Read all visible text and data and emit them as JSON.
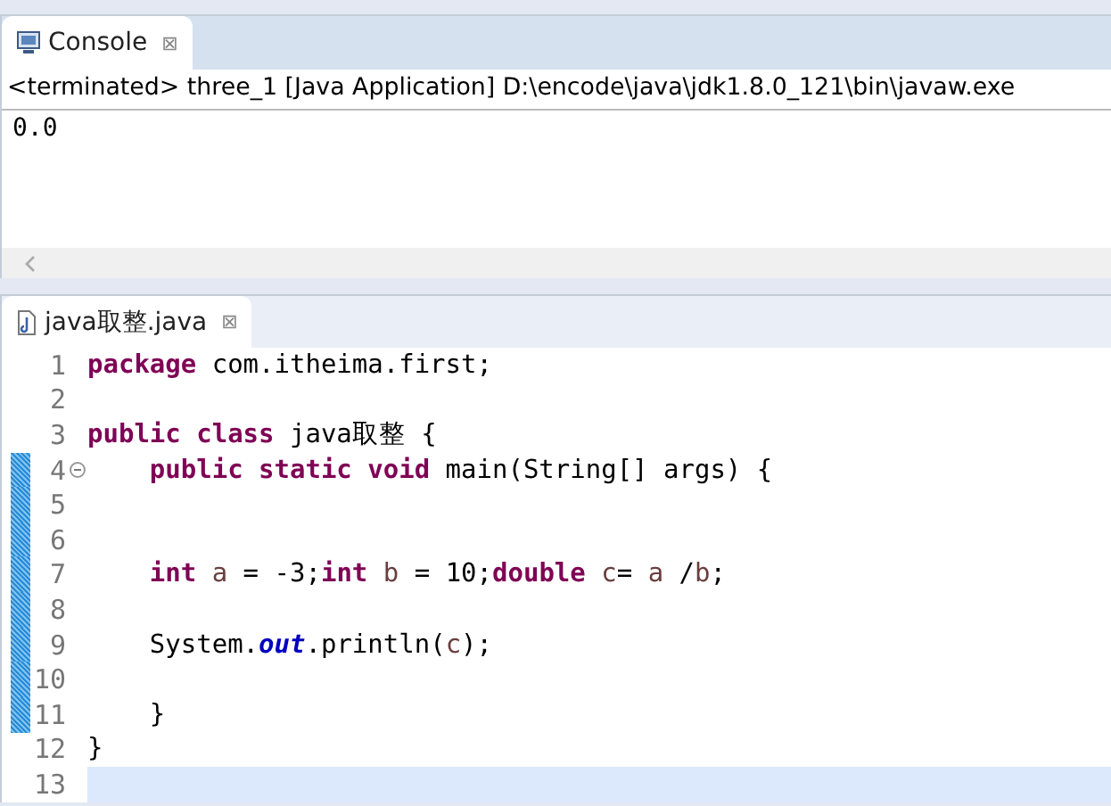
{
  "console": {
    "tab": {
      "title": "Console",
      "close": "⊠",
      "selected": true
    },
    "header": "<terminated> three_1 [Java Application] D:\\encode\\java\\jdk1.8.0_121\\bin\\javaw.exe",
    "output": [
      "0.0"
    ]
  },
  "editor": {
    "tab": {
      "title": "java取整.java",
      "close": "⊠",
      "selected": true
    },
    "lines": [
      {
        "number": "1",
        "changed": false,
        "current": false,
        "foldable": false,
        "tokens": [
          {
            "kind": "keyword",
            "text": "package"
          },
          {
            "kind": "text",
            "text": " com.itheima.first;"
          }
        ]
      },
      {
        "number": "2",
        "changed": false,
        "current": false,
        "foldable": false
      },
      {
        "number": "3",
        "changed": false,
        "current": false,
        "foldable": false,
        "tokens": [
          {
            "kind": "keyword",
            "text": "public "
          },
          {
            "kind": "keyword",
            "text": "class"
          },
          {
            "kind": "text",
            "text": " java取整 {"
          }
        ]
      },
      {
        "number": "4",
        "changed": true,
        "current": false,
        "foldable": true,
        "tokens": [
          {
            "kind": "keyword",
            "text": "    public "
          },
          {
            "kind": "keyword",
            "text": "static "
          },
          {
            "kind": "keyword",
            "text": "void"
          },
          {
            "kind": "text",
            "text": " main(String[] args) {"
          }
        ]
      },
      {
        "number": "5",
        "changed": true,
        "current": false,
        "foldable": false
      },
      {
        "number": "6",
        "changed": true,
        "current": false,
        "foldable": false
      },
      {
        "number": "7",
        "changed": true,
        "current": false,
        "foldable": false,
        "tokens": [
          {
            "kind": "keyword",
            "text": "    int "
          },
          {
            "kind": "local",
            "text": "a"
          },
          {
            "kind": "text",
            "text": " = -3;"
          },
          {
            "kind": "keyword",
            "text": "int "
          },
          {
            "kind": "local",
            "text": "b"
          },
          {
            "kind": "text",
            "text": " = 10;"
          },
          {
            "kind": "keyword",
            "text": "double "
          },
          {
            "kind": "local",
            "text": "c"
          },
          {
            "kind": "text",
            "text": "= "
          },
          {
            "kind": "local",
            "text": "a"
          },
          {
            "kind": "text",
            "text": " /"
          },
          {
            "kind": "local",
            "text": "b"
          },
          {
            "kind": "text",
            "text": ";"
          }
        ]
      },
      {
        "number": "8",
        "changed": true,
        "current": false,
        "foldable": false
      },
      {
        "number": "9",
        "changed": true,
        "current": false,
        "foldable": false,
        "tokens": [
          {
            "kind": "text",
            "text": "    System."
          },
          {
            "kind": "field",
            "text": "out"
          },
          {
            "kind": "text",
            "text": ".println("
          },
          {
            "kind": "local",
            "text": "c"
          },
          {
            "kind": "text",
            "text": ");"
          }
        ]
      },
      {
        "number": "10",
        "changed": true,
        "current": false,
        "foldable": false
      },
      {
        "number": "11",
        "changed": true,
        "current": false,
        "foldable": false,
        "tokens": [
          {
            "kind": "text",
            "text": "    }"
          }
        ]
      },
      {
        "number": "12",
        "changed": false,
        "current": false,
        "foldable": false,
        "tokens": [
          {
            "kind": "text",
            "text": "}"
          }
        ]
      },
      {
        "number": "13",
        "changed": false,
        "current": true,
        "foldable": false
      }
    ]
  }
}
